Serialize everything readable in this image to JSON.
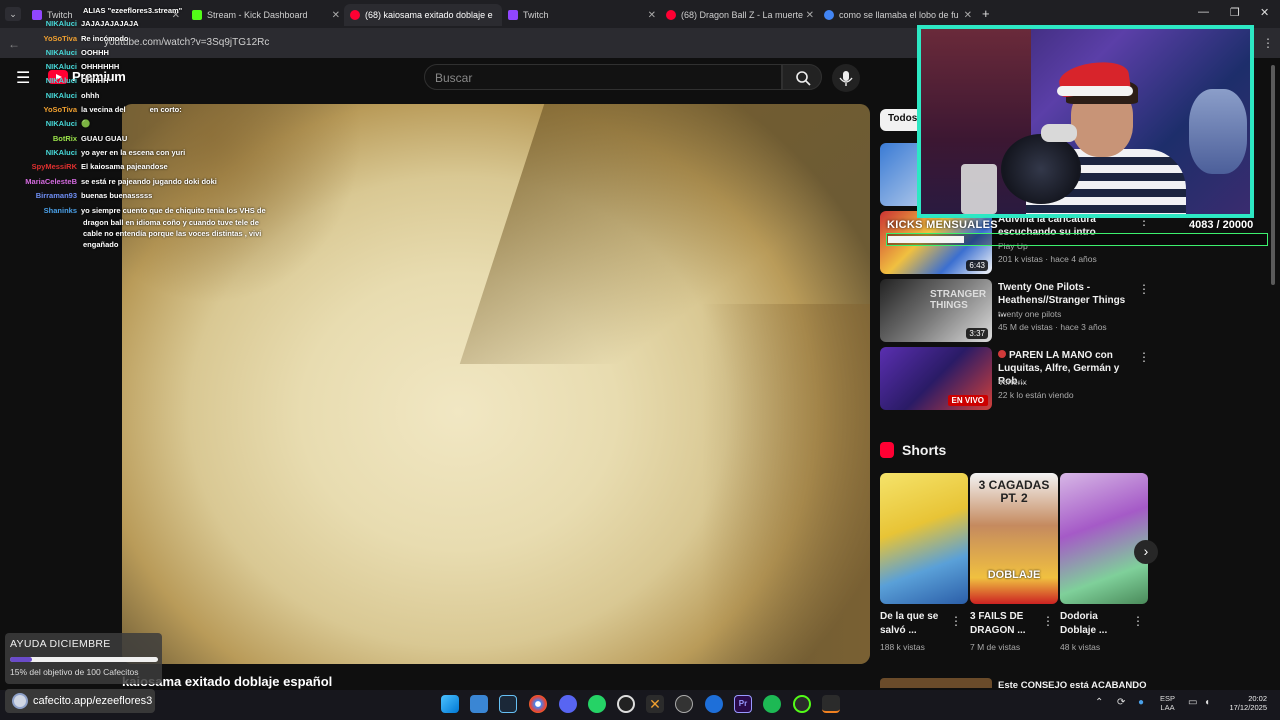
{
  "browser": {
    "tabs": [
      {
        "label": "Twitch",
        "favicon_color": "#9146ff"
      },
      {
        "label": "Stream - Kick Dashboard",
        "favicon_color": "#53fc18"
      },
      {
        "label": "(68) kaiosama exitado doblaje e",
        "favicon_color": "#ff0033"
      },
      {
        "label": "Twitch",
        "favicon_color": "#9146ff"
      },
      {
        "label": "(68) Dragon Ball Z - La muerte",
        "favicon_color": "#ff0033"
      },
      {
        "label": "como se llamaba el lobo de fu",
        "favicon_color": "#4285f4"
      }
    ],
    "url": "youtube.com/watch?v=3Sq9jTG12Rc"
  },
  "youtube": {
    "logo_text": "Premium",
    "search_placeholder": "Buscar",
    "video_title": "kaiosama exitado doblaje español",
    "chip_all": "Todos",
    "recommendations": [
      {
        "title": "Adivina la caricatura escuchando su intro",
        "channel": "Play Up",
        "meta": "201 k vistas · hace 4 años",
        "duration": "6:43"
      },
      {
        "title": "Twenty One Pilots - Heathens//Stranger Things ...",
        "channel": "twenty one pilots",
        "meta": "45 M de vistas · hace 3 años",
        "duration": "3:37"
      },
      {
        "title": "PAREN LA MANO con Luquitas, Alfre, Germán y Rob...",
        "channel": "Vorterix",
        "meta": "22 k lo están viendo",
        "duration": "EN VIVO"
      }
    ],
    "shorts_heading": "Shorts",
    "shorts": [
      {
        "title": "De la que se salvó ...",
        "views": "188 k vistas",
        "thumb_text": ""
      },
      {
        "title": "3 FAILS DE DRAGON ...",
        "views": "7 M de vistas",
        "thumb_text": "3 CAGADAS PT. 2",
        "thumb_text2": "DOBLAJE"
      },
      {
        "title": "Dodoria Doblaje ...",
        "views": "48 k vistas",
        "thumb_text": ""
      }
    ],
    "next_rec_title": "Este CONSEJO está ACABANDO"
  },
  "chat": {
    "messages": [
      {
        "user": "",
        "color": "#ffffff",
        "text": "ALIAS \"ezeeflores3.stream\""
      },
      {
        "user": "NIKAluci",
        "color": "#47d9d9",
        "text": "JAJAJAJAJAJA"
      },
      {
        "user": "YoSoTiva",
        "color": "#f0a030",
        "text": "Re incómodo"
      },
      {
        "user": "NIKAluci",
        "color": "#47d9d9",
        "text": "OOHHH"
      },
      {
        "user": "NIKAluci",
        "color": "#47d9d9",
        "text": "OHHHHHH"
      },
      {
        "user": "NIKAluci",
        "color": "#47d9d9",
        "text": "OHHHH"
      },
      {
        "user": "NIKAluci",
        "color": "#47d9d9",
        "text": "ohhh"
      },
      {
        "user": "YoSoTiva",
        "color": "#f0a030",
        "text": "la vecina del",
        "text2": "en corto:"
      },
      {
        "user": "NIKAluci",
        "color": "#47d9d9",
        "text": "🟢"
      },
      {
        "user": "BotRix",
        "color": "#9be34a",
        "text": "GUAU GUAU"
      },
      {
        "user": "NIKAluci",
        "color": "#47d9d9",
        "text": "yo ayer en la escena con yuri"
      },
      {
        "user": "SpyMessiRK",
        "color": "#e0302f",
        "text": "El kaiosama pajeandose"
      },
      {
        "user": "MariaCelesteB",
        "color": "#d46adf",
        "text": "se está re pajeando jugando doki doki"
      },
      {
        "user": "Birraman93",
        "color": "#6f8ff5",
        "text": "buenas buenasssss"
      },
      {
        "user": "Shaninks",
        "color": "#4aa0e8",
        "text": "yo siempre cuento que de chiquito tenia los VHS de"
      },
      {
        "user": "",
        "color": "#ffffff",
        "text": "dragon ball en idioma coño y cuando tuve tele de"
      },
      {
        "user": "",
        "color": "#ffffff",
        "text": "cable no entendía porque las voces distintas , vivi"
      },
      {
        "user": "",
        "color": "#ffffff",
        "text": "engañado"
      }
    ]
  },
  "overlay": {
    "kicks_label": "KICKS MENSUALES",
    "kicks_count": "4083  / 20000",
    "kicks_progress": 0.2,
    "donation_title": "AYUDA DICIEMBRE",
    "donation_sub": "15% del objetivo de 100 Cafecitos",
    "donation_progress": 0.15,
    "cafecito_text": "cafecito.app/ezeeflores3"
  },
  "taskbar": {
    "lang_1": "ESP",
    "lang_2": "LAA",
    "time": "20:02",
    "date": "17/12/2025"
  },
  "colors": {
    "webcam_border": "#2de8c4",
    "kicks_bar": "#3df06e",
    "yt_red": "#ff0033"
  }
}
